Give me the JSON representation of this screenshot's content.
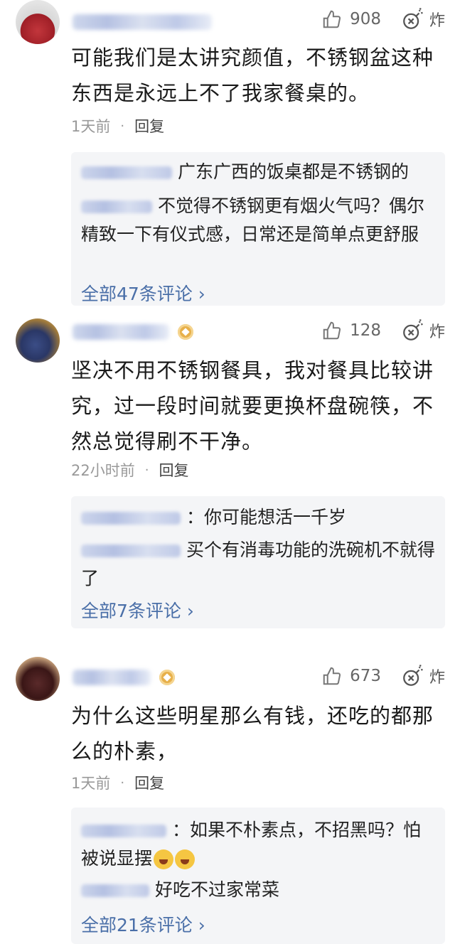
{
  "comments": [
    {
      "likes": "908",
      "bomb_label": "炸",
      "text": "可能我们是太讲究颜值，不锈钢盆这种东西是永远上不了我家餐桌的。",
      "time": "1天前",
      "dot": "·",
      "reply_label": "回复",
      "replies": [
        {
          "text": "广东广西的饭桌都是不锈钢的"
        },
        {
          "text": "不觉得不锈钢更有烟火气吗？偶尔精致一下有仪式感，日常还是简单点更舒服"
        }
      ],
      "more": "全部47条评论 ›"
    },
    {
      "likes": "128",
      "bomb_label": "炸",
      "text": "坚决不用不锈钢餐具，我对餐具比较讲究，过一段时间就要更换杯盘碗筷，不然总觉得刷不干净。",
      "time": "22小时前",
      "dot": "·",
      "reply_label": "回复",
      "replies": [
        {
          "text": "：你可能想活一千岁"
        },
        {
          "text": "买个有消毒功能的洗碗机不就得了"
        }
      ],
      "more": "全部7条评论 ›"
    },
    {
      "likes": "673",
      "bomb_label": "炸",
      "text": "为什么这些明星那么有钱，还吃的都那么的朴素，",
      "time": "1天前",
      "dot": "·",
      "reply_label": "回复",
      "replies": [
        {
          "text": "：如果不朴素点，不招黑吗？怕被说显摆"
        },
        {
          "text": "好吃不过家常菜"
        }
      ],
      "more": "全部21条评论 ›"
    }
  ]
}
